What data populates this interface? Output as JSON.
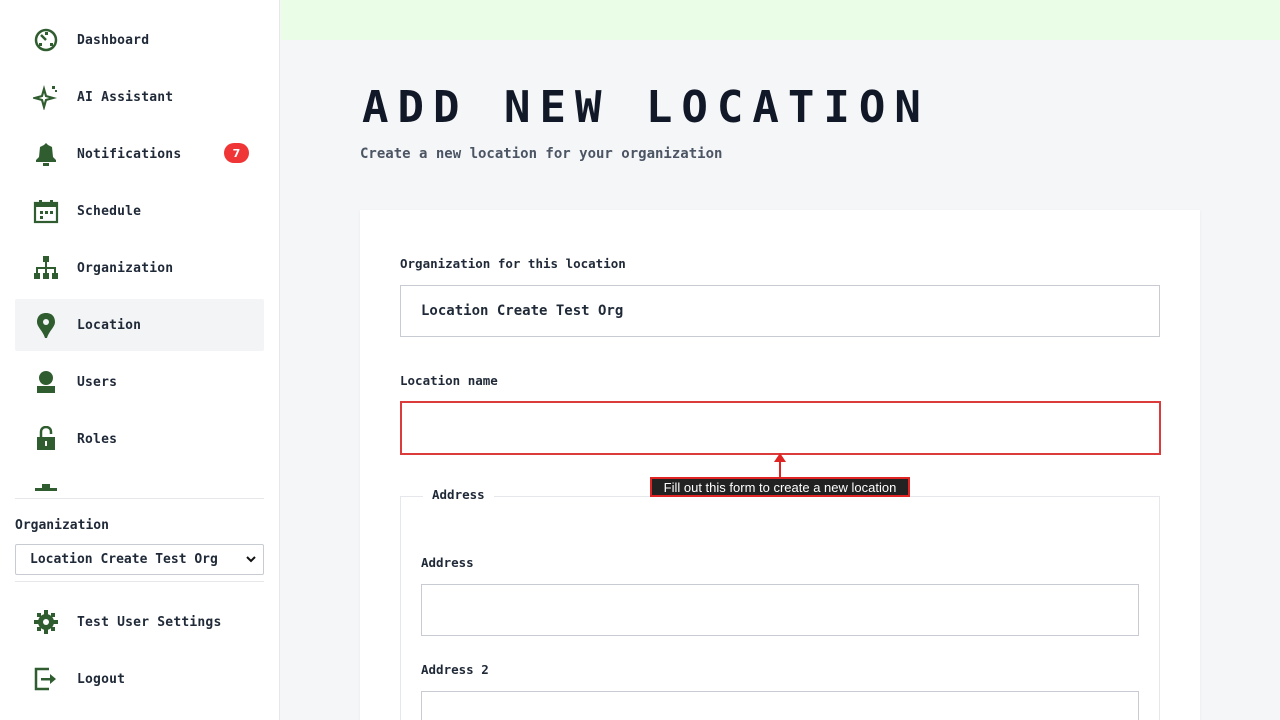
{
  "sidebar": {
    "nav": [
      {
        "label": "Dashboard",
        "icon": "dashboard-icon"
      },
      {
        "label": "AI Assistant",
        "icon": "sparkle-icon"
      },
      {
        "label": "Notifications",
        "icon": "bell-icon",
        "badge": "7"
      },
      {
        "label": "Schedule",
        "icon": "calendar-icon"
      },
      {
        "label": "Organization",
        "icon": "org-chart-icon"
      },
      {
        "label": "Location",
        "icon": "location-pin-icon",
        "active": true
      },
      {
        "label": "Users",
        "icon": "user-icon"
      },
      {
        "label": "Roles",
        "icon": "lock-icon"
      }
    ],
    "organization_label": "Organization",
    "organization_selected": "Location Create Test Org",
    "bottom": [
      {
        "label": "Test User Settings",
        "icon": "gear-icon"
      },
      {
        "label": "Logout",
        "icon": "logout-icon"
      }
    ]
  },
  "main": {
    "title": "ADD NEW LOCATION",
    "subtitle": "Create a new location for your organization",
    "form": {
      "org_label": "Organization for this location",
      "org_value": "Location Create Test Org",
      "name_label": "Location name",
      "name_value": "",
      "address_legend": "Address",
      "address_label": "Address",
      "address_value": "",
      "address2_label": "Address 2",
      "address2_value": ""
    },
    "tooltip": "Fill out this form to create a new location"
  },
  "colors": {
    "accent": "#2f5d2f",
    "badge": "#ef3535",
    "error": "#dc3b3b",
    "topbar": "#eafde6"
  }
}
